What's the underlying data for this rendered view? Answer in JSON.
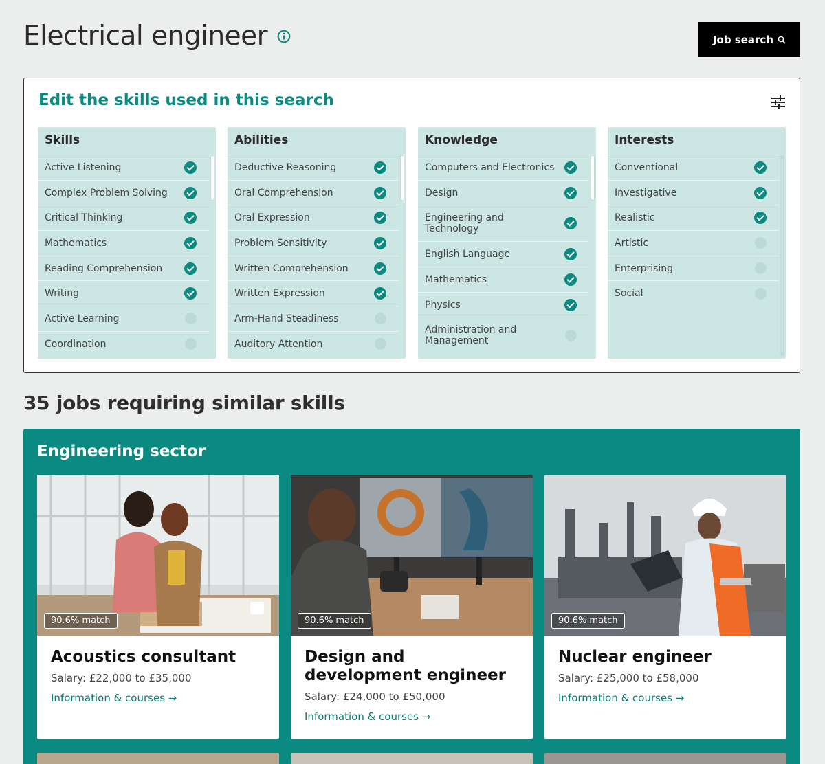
{
  "page": {
    "title": "Electrical engineer",
    "job_search_label": "Job search"
  },
  "skills_panel": {
    "title": "Edit the skills used in this search",
    "columns": [
      {
        "heading": "Skills",
        "items": [
          {
            "label": "Active Listening",
            "checked": true
          },
          {
            "label": "Complex Problem Solving",
            "checked": true
          },
          {
            "label": "Critical Thinking",
            "checked": true
          },
          {
            "label": "Mathematics",
            "checked": true
          },
          {
            "label": "Reading Comprehension",
            "checked": true
          },
          {
            "label": "Writing",
            "checked": true
          },
          {
            "label": "Active Learning",
            "checked": false
          },
          {
            "label": "Coordination",
            "checked": false
          }
        ]
      },
      {
        "heading": "Abilities",
        "items": [
          {
            "label": "Deductive Reasoning",
            "checked": true
          },
          {
            "label": "Oral Comprehension",
            "checked": true
          },
          {
            "label": "Oral Expression",
            "checked": true
          },
          {
            "label": "Problem Sensitivity",
            "checked": true
          },
          {
            "label": "Written Comprehension",
            "checked": true
          },
          {
            "label": "Written Expression",
            "checked": true
          },
          {
            "label": "Arm-Hand Steadiness",
            "checked": false
          },
          {
            "label": "Auditory Attention",
            "checked": false
          }
        ]
      },
      {
        "heading": "Knowledge",
        "items": [
          {
            "label": "Computers and Electronics",
            "checked": true
          },
          {
            "label": "Design",
            "checked": true
          },
          {
            "label": "Engineering and Technology",
            "checked": true
          },
          {
            "label": "English Language",
            "checked": true
          },
          {
            "label": "Mathematics",
            "checked": true
          },
          {
            "label": "Physics",
            "checked": true
          },
          {
            "label": "Administration and Management",
            "checked": false
          }
        ]
      },
      {
        "heading": "Interests",
        "items": [
          {
            "label": "Conventional",
            "checked": true
          },
          {
            "label": "Investigative",
            "checked": true
          },
          {
            "label": "Realistic",
            "checked": true
          },
          {
            "label": "Artistic",
            "checked": false
          },
          {
            "label": "Enterprising",
            "checked": false
          },
          {
            "label": "Social",
            "checked": false
          }
        ]
      }
    ]
  },
  "results": {
    "heading": "35 jobs requiring similar skills",
    "sector": "Engineering sector",
    "cards": [
      {
        "match": "90.6% match",
        "title": "Acoustics consultant",
        "salary": "Salary: £22,000 to £35,000",
        "link": "Information & courses →"
      },
      {
        "match": "90.6% match",
        "title": "Design and development engineer",
        "salary": "Salary: £24,000 to £50,000",
        "link": "Information & courses →"
      },
      {
        "match": "90.6% match",
        "title": "Nuclear engineer",
        "salary": "Salary: £25,000 to £58,000",
        "link": "Information & courses →"
      }
    ]
  },
  "colors": {
    "accent": "#0b8a82",
    "panel_bg": "#cce6e4",
    "page_bg": "#eceeed"
  }
}
